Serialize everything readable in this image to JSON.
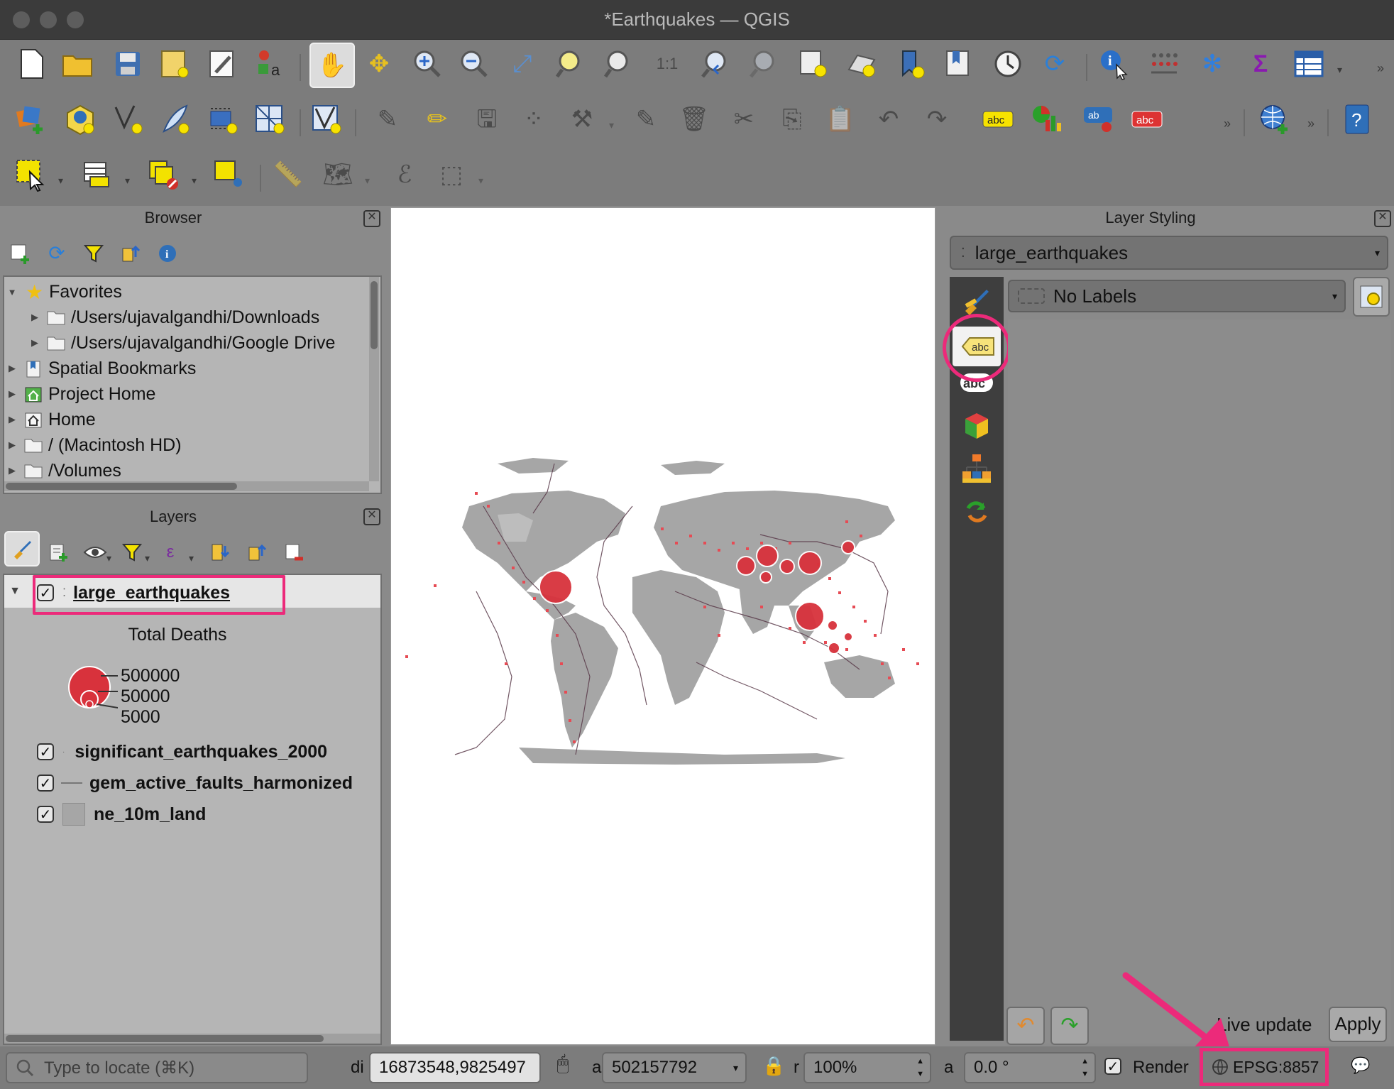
{
  "window": {
    "title": "*Earthquakes — QGIS"
  },
  "browser": {
    "title": "Browser",
    "items": [
      {
        "label": "Favorites",
        "icon": "star-icon"
      },
      {
        "label": "/Users/ujavalgandhi/Downloads",
        "icon": "folder-icon"
      },
      {
        "label": "/Users/ujavalgandhi/Google Drive",
        "icon": "folder-icon"
      },
      {
        "label": "Spatial Bookmarks",
        "icon": "bookmark-icon"
      },
      {
        "label": "Project Home",
        "icon": "project-home-icon"
      },
      {
        "label": "Home",
        "icon": "home-icon"
      },
      {
        "label": "/ (Macintosh HD)",
        "icon": "folder-icon"
      },
      {
        "label": "/Volumes",
        "icon": "folder-icon"
      }
    ]
  },
  "layers": {
    "title": "Layers",
    "items": [
      {
        "name": "large_earthquakes",
        "checked": true
      },
      {
        "name": "significant_earthquakes_2000",
        "checked": true
      },
      {
        "name": "gem_active_faults_harmonized",
        "checked": true
      },
      {
        "name": "ne_10m_land",
        "checked": true
      }
    ],
    "legend": {
      "title": "Total Deaths",
      "values": [
        "500000",
        "50000",
        "5000"
      ]
    }
  },
  "styling": {
    "title": "Layer Styling",
    "layer_selected": "large_earthquakes",
    "labels_mode": "No Labels",
    "live_update": "Live update",
    "apply": "Apply"
  },
  "statusbar": {
    "locate_placeholder": "Type to locate (⌘K)",
    "coordinate_label": "di",
    "coordinate": "16873548,9825497",
    "scale_label": "a",
    "scale": "502157792",
    "magnifier_label": "r",
    "magnifier": "100%",
    "rotation_label": "a",
    "rotation": "0.0 °",
    "render": "Render",
    "crs": "EPSG:8857"
  },
  "colors": {
    "accent": "#ec2a7a",
    "quake_red": "#d8323c",
    "land_grey": "#a6a6a6"
  }
}
